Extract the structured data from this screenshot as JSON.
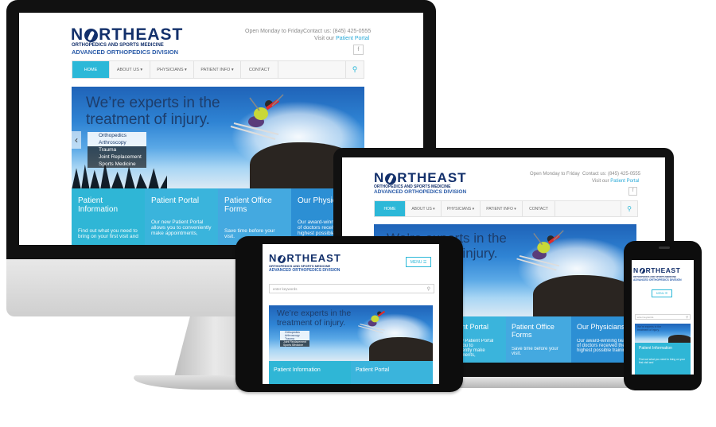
{
  "brand": {
    "name_prefix": "N",
    "name_rest": "RTHEAST",
    "line1": "ORTHOPEDICS AND SPORTS MEDICINE",
    "line2": "ADVANCED ORTHOPEDICS DIVISION"
  },
  "header": {
    "hours": "Open Monday to Friday",
    "contact": "Contact us: (845) 425-0555",
    "visit_prefix": "Visit our",
    "portal_link": "Patient Portal",
    "facebook": "f"
  },
  "nav": {
    "items": [
      "HOME",
      "ABOUT US ▾",
      "PHYSICIANS ▾",
      "PATIENT INFO ▾",
      "CONTACT"
    ],
    "search_icon": "search-icon"
  },
  "hero": {
    "headline_1": "We’re experts in the",
    "headline_2": "treatment of injury.",
    "slides": [
      "Orthopedics",
      "Arthroscopy",
      "Trauma",
      "Joint Replacement",
      "Sports Medicine"
    ],
    "prev_arrow": "‹"
  },
  "tiles": [
    {
      "title": "Patient Information",
      "body": "Find out what you need to bring on your first visit and"
    },
    {
      "title": "Patient Portal",
      "body": "Our new Patient Portal allows you to conveniently make appointments,"
    },
    {
      "title": "Patient Office Forms",
      "body": "Save time before your visit."
    },
    {
      "title": "Our Physicians",
      "body": "Our award-winning team of doctors received the highest possible training"
    }
  ],
  "mobile": {
    "menu_label": "MENU ☰",
    "search_placeholder": "enter keywords"
  },
  "colors": {
    "accent": "#2cb8d8",
    "brand_navy": "#13306b",
    "tile_1": "#2fb6d6",
    "tile_2": "#3ab4dc",
    "tile_3": "#44a9e0",
    "tile_4": "#2c8fd4"
  }
}
